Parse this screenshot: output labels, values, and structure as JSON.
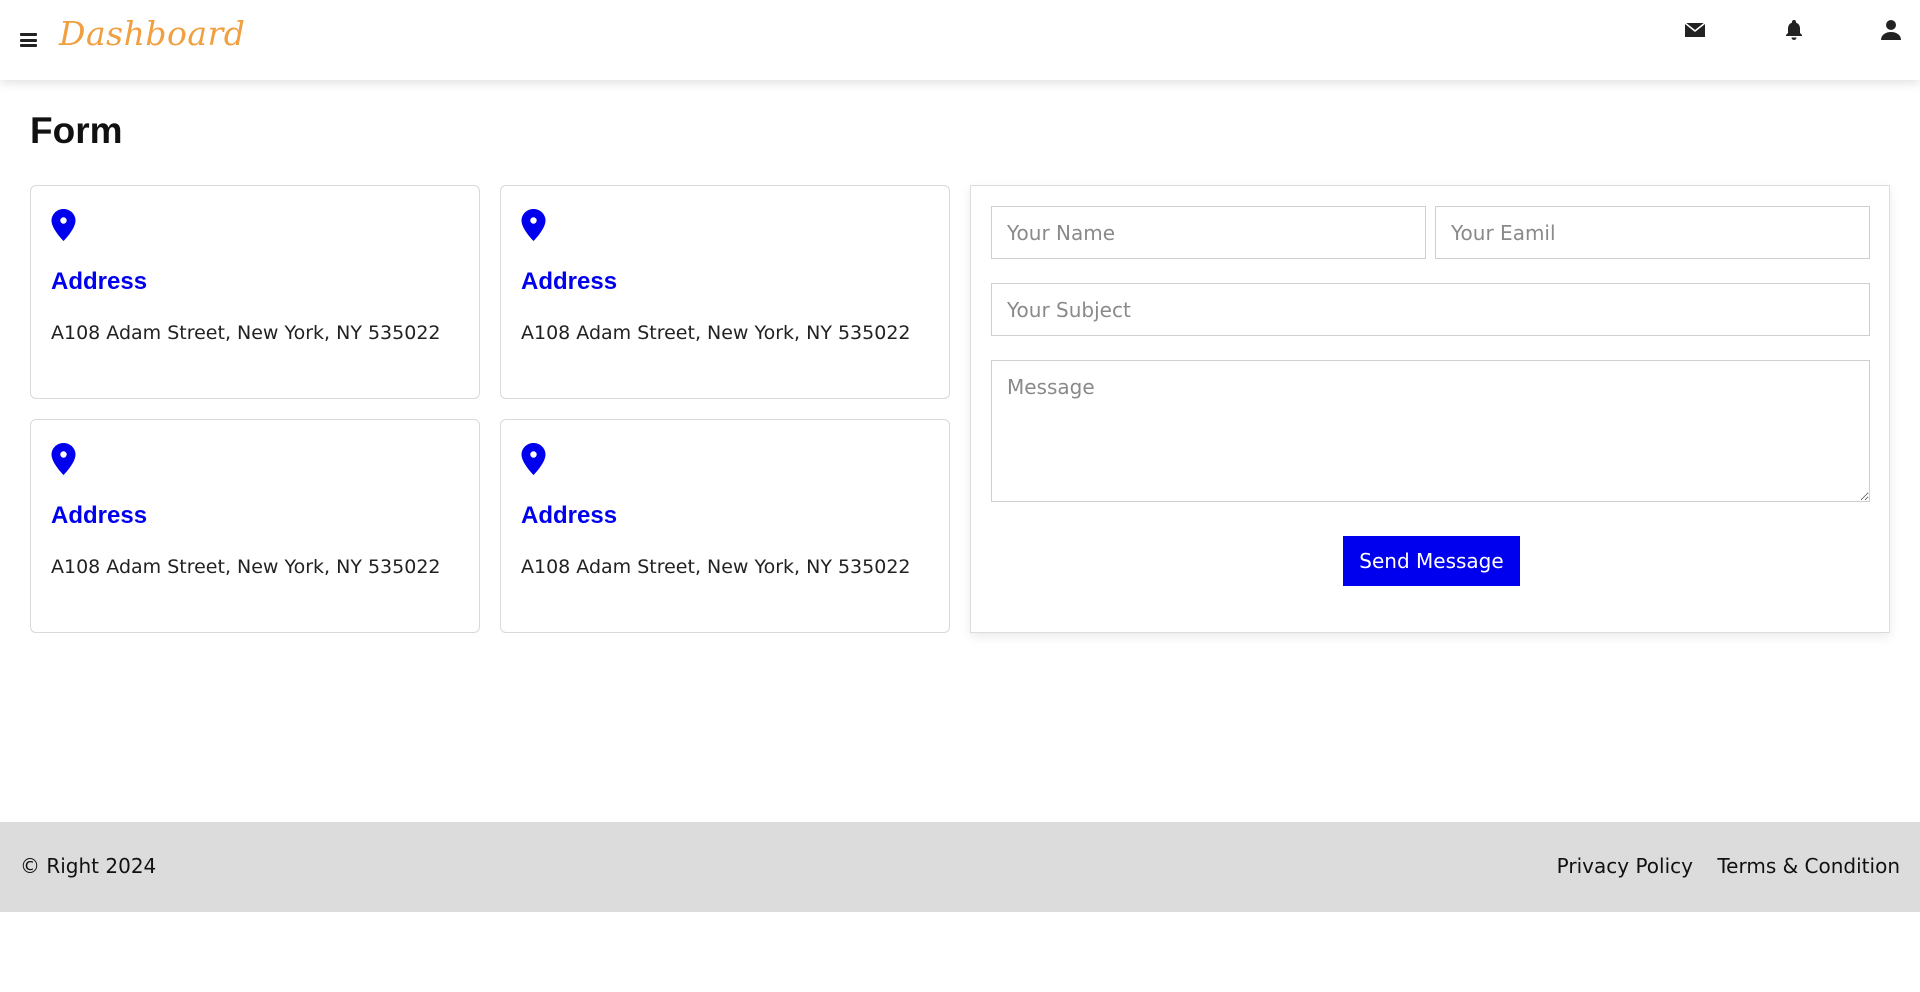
{
  "header": {
    "brand": "Dashboard",
    "brand_color": "#f0a040",
    "icons": [
      "menu-icon",
      "mail-icon",
      "bell-icon",
      "user-icon"
    ]
  },
  "page": {
    "title": "Form"
  },
  "addresses": [
    {
      "icon": "map-pin-icon",
      "title": "Address",
      "text": "A108 Adam Street, New York, NY 535022"
    },
    {
      "icon": "map-pin-icon",
      "title": "Address",
      "text": "A108 Adam Street, New York, NY 535022"
    },
    {
      "icon": "map-pin-icon",
      "title": "Address",
      "text": "A108 Adam Street, New York, NY 535022"
    },
    {
      "icon": "map-pin-icon",
      "title": "Address",
      "text": "A108 Adam Street, New York, NY 535022"
    }
  ],
  "form": {
    "name_placeholder": "Your Name",
    "email_placeholder": "Your Eamil",
    "subject_placeholder": "Your Subject",
    "message_placeholder": "Message",
    "submit_label": "Send Message",
    "accent_color": "#0000ee"
  },
  "footer": {
    "copyright": "© Right 2024",
    "links": [
      "Privacy Policy",
      "Terms & Condition"
    ]
  }
}
